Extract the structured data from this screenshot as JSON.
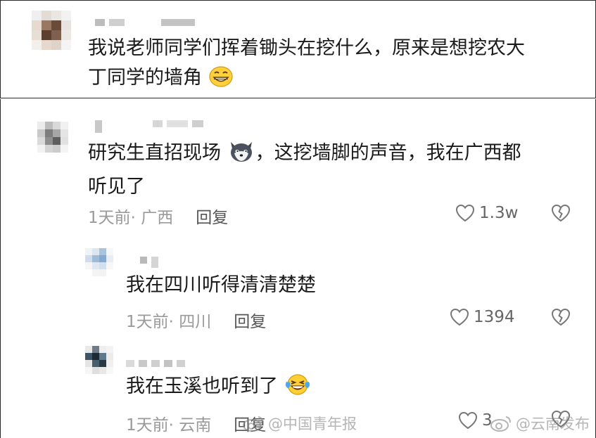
{
  "comment_top": {
    "text_line1": "我说老师同学们挥着锄头在挖什么，原来是想挖农大",
    "text_line2": "丁同学的墙角",
    "emoji": "grinning-face-emoji"
  },
  "comment_main": {
    "text_line1": "研究生直招现场",
    "text_line1_rest": "，这挖墙脚的声音，我在广西都",
    "text_line2": "听见了",
    "emoji": "dog-face-emoji",
    "time": "1天前",
    "location": "· 广西",
    "reply_label": "回复",
    "like_count": "1.3w"
  },
  "replies": [
    {
      "text": "我在四川听得清清楚楚",
      "time": "1天前",
      "location": "· 四川",
      "reply_label": "回复",
      "like_count": "1394"
    },
    {
      "text": "我在玉溪也听到了",
      "emoji": "laughing-tears-emoji",
      "time": "1天前",
      "location": "· 云南",
      "reply_label": "回复",
      "like_count": "3"
    }
  ],
  "watermarks": {
    "left": "@中国青年报",
    "right": "@云南发布"
  },
  "colors": {
    "text": "#1a1a1a",
    "meta": "#9a9a9a",
    "border": "#2a2a2a"
  }
}
